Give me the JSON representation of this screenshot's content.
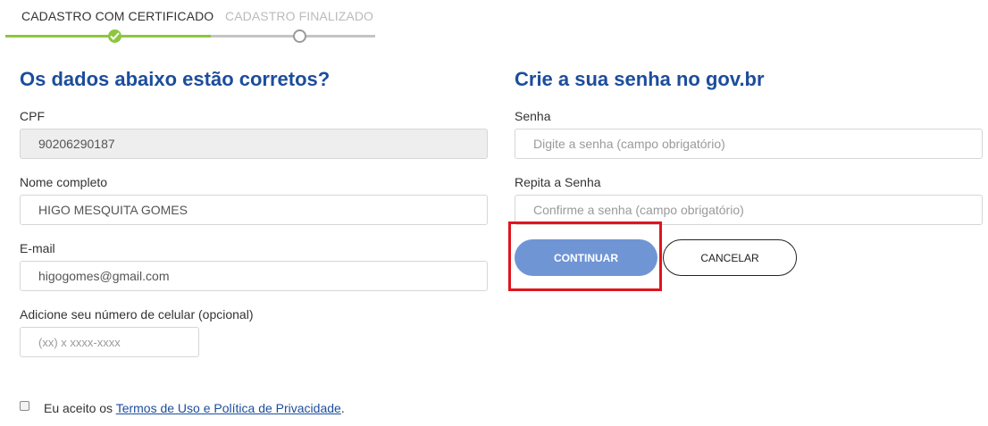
{
  "stepper": {
    "steps": [
      {
        "label": "CADASTRO COM CERTIFICADO",
        "status": "completed"
      },
      {
        "label": "CADASTRO FINALIZADO",
        "status": "pending"
      }
    ]
  },
  "left_section": {
    "title": "Os dados abaixo estão corretos?",
    "cpf": {
      "label": "CPF",
      "value": "90206290187"
    },
    "name": {
      "label": "Nome completo",
      "value": "HIGO MESQUITA GOMES"
    },
    "email": {
      "label": "E-mail",
      "value": "higogomes@gmail.com"
    },
    "phone": {
      "label": "Adicione seu número de celular (opcional)",
      "value": "",
      "placeholder": "(xx) x xxxx-xxxx"
    }
  },
  "right_section": {
    "title": "Crie a sua senha no gov.br",
    "password": {
      "label": "Senha",
      "value": "",
      "placeholder": "Digite a senha (campo obrigatório)"
    },
    "confirm": {
      "label": "Repita a Senha",
      "value": "",
      "placeholder": "Confirme a senha (campo obrigatório)"
    }
  },
  "buttons": {
    "continue": "CONTINUAR",
    "cancel": "CANCELAR"
  },
  "terms": {
    "prefix": "Eu aceito os ",
    "link": "Termos de Uso e Política de Privacidade",
    "suffix": ".",
    "checked": false
  },
  "colors": {
    "heading": "#1c4d9c",
    "progress_done": "#8cc63f",
    "progress_pending": "#c4c4c4",
    "primary_button": "#6f95d5",
    "highlight": "#e0141e"
  },
  "icons": {
    "step_done": "check-icon",
    "step_pending": "circle-icon"
  }
}
